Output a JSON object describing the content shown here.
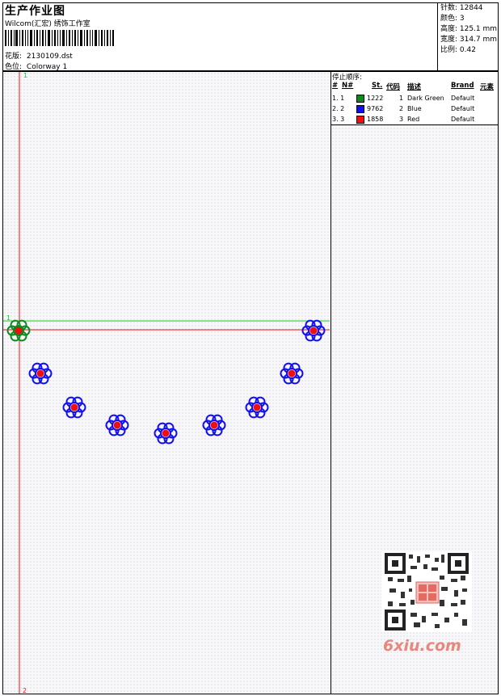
{
  "header": {
    "title": "生产作业图",
    "company": "Wilcom(汇宏) 绣饰工作室",
    "design_label": "花版:",
    "design_value": "2130109.dst",
    "colorway_label": "色位:",
    "colorway_value": "Colorway 1"
  },
  "stats": {
    "stitches": "针数: 12844",
    "colors": "颜色: 3",
    "height": "高度: 125.1 mm",
    "width": "宽度: 314.7 mm",
    "scale": "比例: 0.42"
  },
  "stop_sequence": {
    "title": "停止顺序:",
    "headers": {
      "hash": "#",
      "no": "N#",
      "st": "St.",
      "code": "代码",
      "desc": "描述",
      "brand": "Brand",
      "element": "元素"
    },
    "rows": [
      {
        "seq": "1. 1",
        "color": "#0d8a1e",
        "st": "1222",
        "code": "1",
        "desc": "Dark Green",
        "brand": "Default"
      },
      {
        "seq": "2. 2",
        "color": "#1010ee",
        "st": "9762",
        "code": "2",
        "desc": "Blue",
        "brand": "Default"
      },
      {
        "seq": "3. 3",
        "color": "#ee1010",
        "st": "1858",
        "code": "3",
        "desc": "Red",
        "brand": "Default"
      }
    ]
  },
  "canvas": {
    "marker_top": "1",
    "marker_mid": "1",
    "marker_bottom": "2",
    "guide_color": "#ee1010",
    "guide_green": "#1ec81e"
  },
  "watermark": {
    "logo_text": "6xiu.com"
  }
}
